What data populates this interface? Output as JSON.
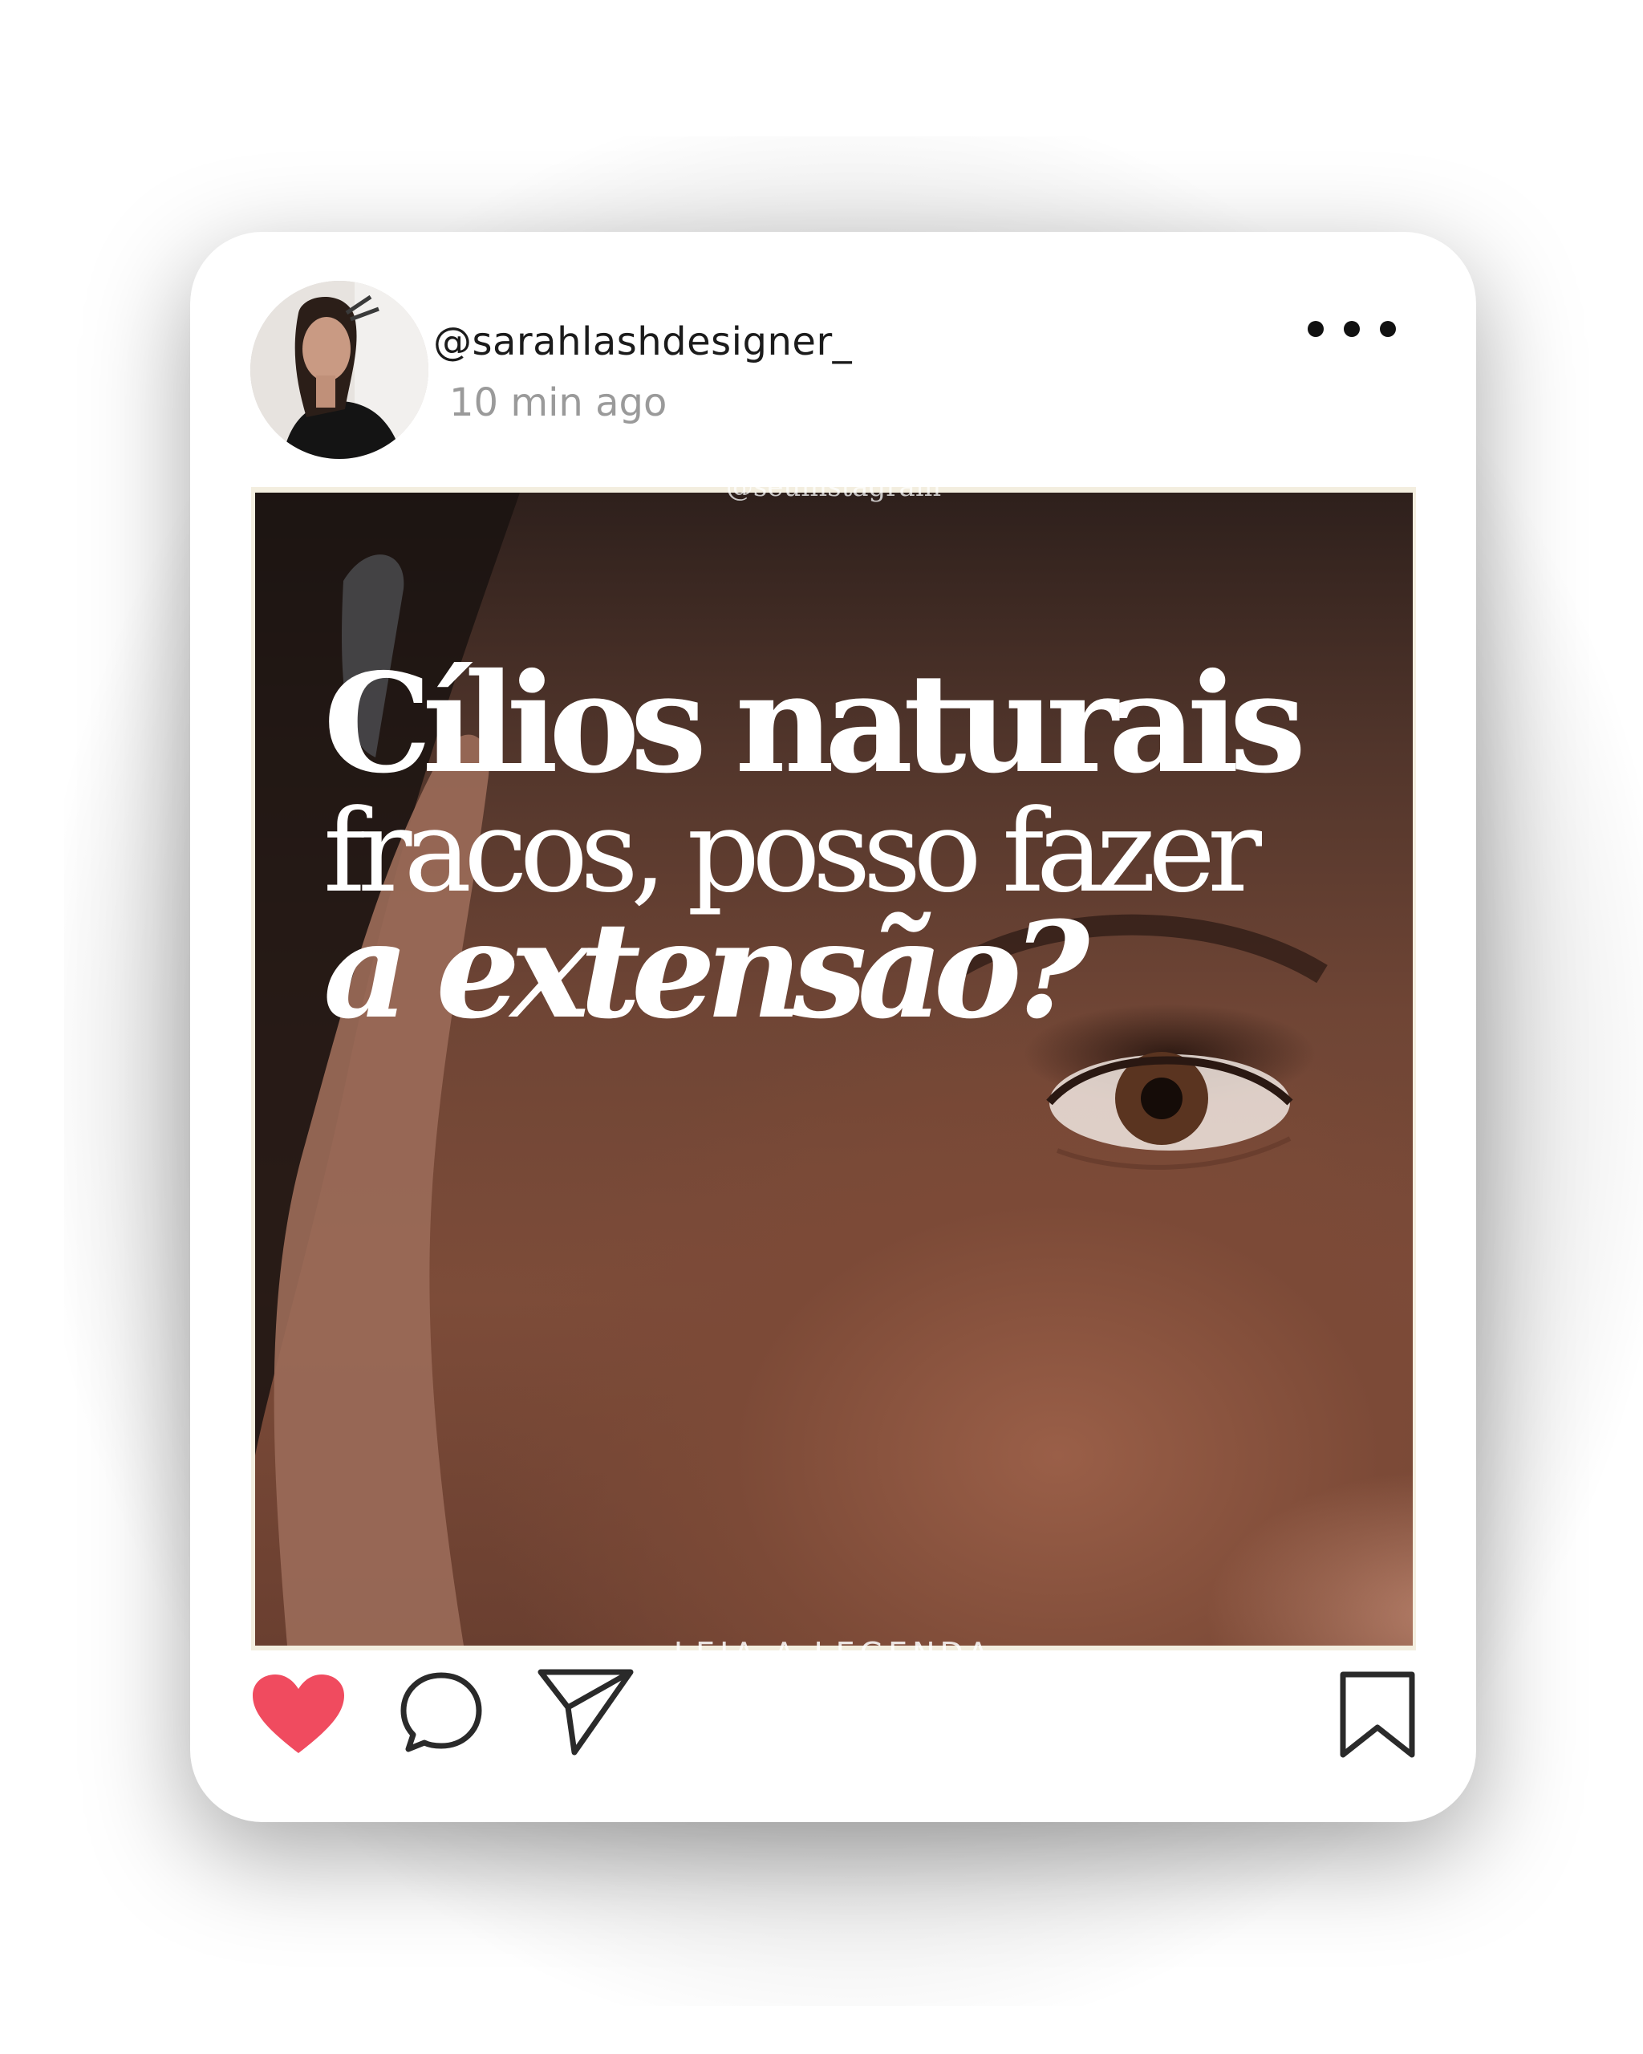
{
  "post": {
    "username": "@sarahlashdesigner_",
    "timestamp": "10 min ago",
    "image": {
      "watermark": "@seuinstagram",
      "headline_line1": "Cílios naturais",
      "headline_line2": "fracos, posso fazer",
      "headline_line3": "a extensão?",
      "footer": "LEIA A LEGENDA"
    }
  },
  "icons": {
    "more": "more-options-icon",
    "like": "heart-icon",
    "comment": "comment-icon",
    "share": "send-icon",
    "save": "bookmark-icon"
  },
  "colors": {
    "like_active": "#f04b5f",
    "icon_stroke": "#2a2a2a",
    "text_primary": "#1b1b1b",
    "text_secondary": "#9a9a9a"
  }
}
